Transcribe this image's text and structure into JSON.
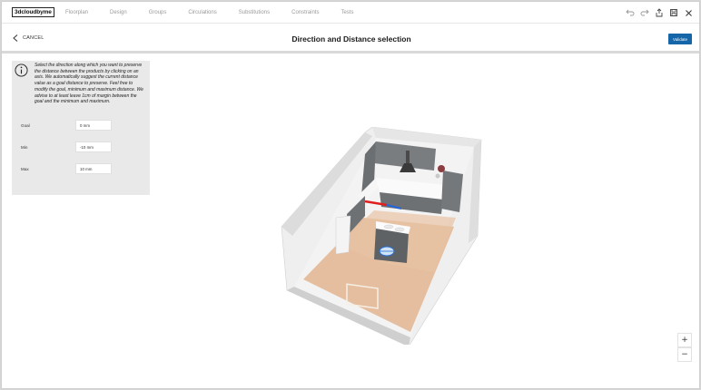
{
  "app": {
    "logo_text": "3dcloudbyme"
  },
  "nav": {
    "links": [
      "Floorplan",
      "Design",
      "Groups",
      "Circulations",
      "Substitutions",
      "Constraints",
      "Tests"
    ],
    "icons": [
      "undo-icon",
      "redo-icon",
      "share-icon",
      "save-icon",
      "close-icon"
    ]
  },
  "header": {
    "cancel_label": "CANCEL",
    "title": "Direction and Distance selection",
    "validate_label": "Validate"
  },
  "panel": {
    "info_text": "Select the direction along which you want to preserve the distance between the products by clicking on an axis. We automatically suggest the current distance value as a goal distance to preserve. Feel free to modify the goal, minimum and maximum distance. We advise to at least leave 1cm of margin between the goal and the minimum and maximum.",
    "fields": [
      {
        "label": "Goal",
        "value": "0 mm"
      },
      {
        "label": "Min",
        "value": "-10 mm"
      },
      {
        "label": "Max",
        "value": "10 mm"
      }
    ]
  },
  "zoom": {
    "in_label": "+",
    "out_label": "−"
  },
  "colors": {
    "accent": "#1466a8",
    "panel_bg": "#e9e9e9",
    "floor": "#e3b896",
    "axis_red": "#e02020",
    "axis_blue": "#2266dd"
  }
}
